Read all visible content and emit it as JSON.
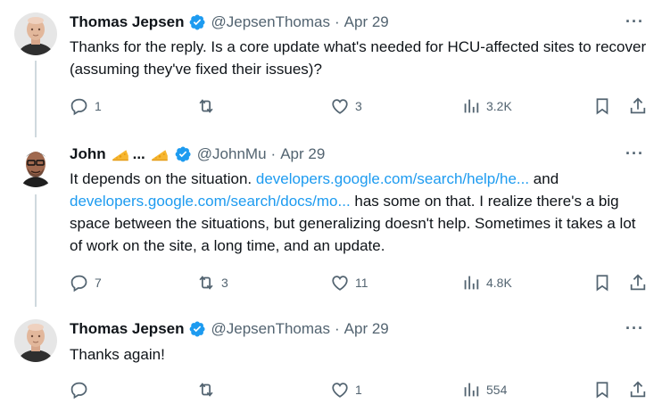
{
  "tweets": [
    {
      "name": "Thomas Jepsen",
      "handle": "@JepsenThomas",
      "separator": "·",
      "date": "Apr 29",
      "text": "Thanks for the reply. Is a core update what's needed for HCU-affected sites to recover (assuming they've fixed their issues)?",
      "replies": "1",
      "reposts": "",
      "likes": "3",
      "views": "3.2K"
    },
    {
      "name": "John",
      "name_suffix": "...",
      "handle": "@JohnMu",
      "separator": "·",
      "date": "Apr 29",
      "text_part1": "It depends on the situation. ",
      "link1": "developers.google.com/search/help/he...",
      "text_part2": " and ",
      "link2": "developers.google.com/search/docs/mo...",
      "text_part3": " has some on that. I realize there's a big space between the situations, but generalizing doesn't help. Sometimes it takes a lot of work on the site, a long time, and an update.",
      "replies": "7",
      "reposts": "3",
      "likes": "11",
      "views": "4.8K"
    },
    {
      "name": "Thomas Jepsen",
      "handle": "@JepsenThomas",
      "separator": "·",
      "date": "Apr 29",
      "text": "Thanks again!",
      "replies": "",
      "reposts": "",
      "likes": "1",
      "views": "554"
    }
  ],
  "icons": {
    "verified": "verified-badge-icon",
    "more": "more-options-icon",
    "reply": "reply-icon",
    "repost": "repost-icon",
    "like": "like-icon",
    "views": "views-icon",
    "bookmark": "bookmark-icon",
    "share": "share-icon",
    "cheese": "cheese-emoji-icon"
  },
  "colors": {
    "link": "#1d9bf0",
    "verified": "#1d9bf0",
    "muted": "#536471",
    "thread_line": "#cfd9de"
  },
  "more_label": "···"
}
